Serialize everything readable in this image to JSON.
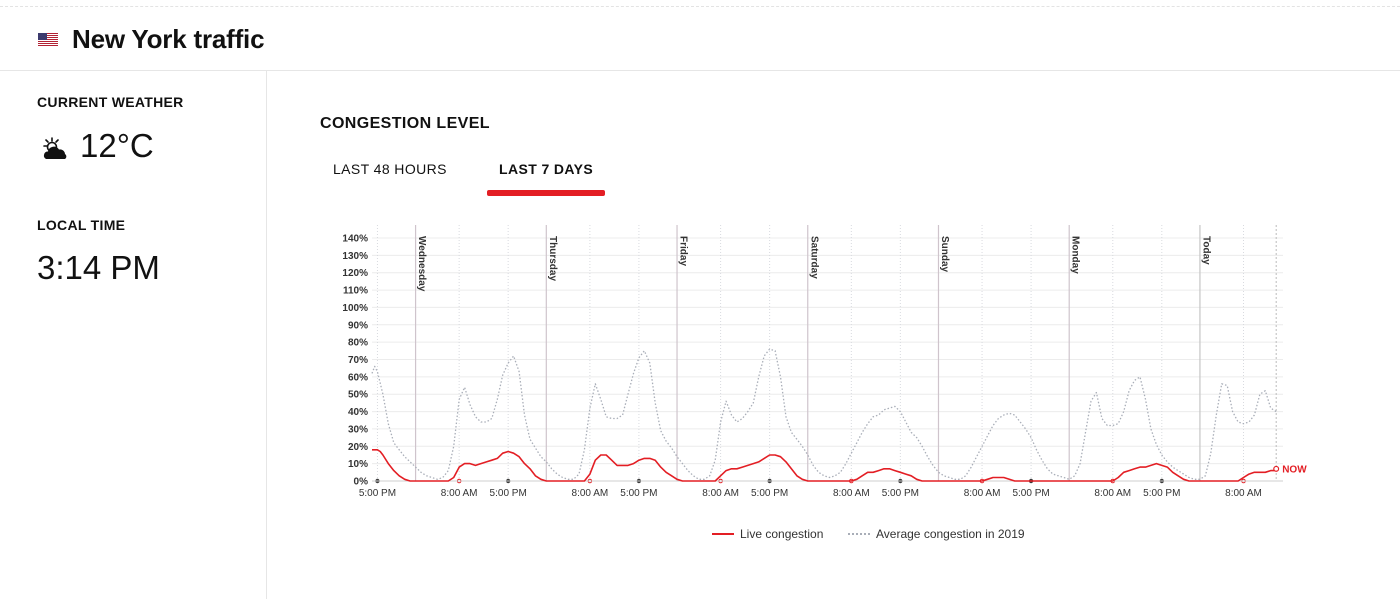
{
  "header": {
    "title": "New York traffic",
    "flag_icon": "us-flag-icon"
  },
  "sidebar": {
    "weather_label": "CURRENT WEATHER",
    "weather_icon": "partly-cloudy-icon",
    "temperature": "12°C",
    "time_label": "LOCAL TIME",
    "local_time": "3:14 PM"
  },
  "main": {
    "section_title": "CONGESTION LEVEL",
    "tabs": [
      {
        "label": "LAST 48 HOURS",
        "active": false
      },
      {
        "label": "LAST 7 DAYS",
        "active": true
      }
    ],
    "accent_color": "#e31e24"
  },
  "chart_data": {
    "type": "line",
    "ylim": [
      0,
      140
    ],
    "ytick_labels": [
      "0%",
      "10%",
      "20%",
      "30%",
      "40%",
      "50%",
      "60%",
      "70%",
      "80%",
      "90%",
      "100%",
      "110%",
      "120%",
      "130%",
      "140%"
    ],
    "x_range_hours": [
      -1,
      166.25
    ],
    "day_labels": [
      "Wednesday",
      "Thursday",
      "Friday",
      "Saturday",
      "Sunday",
      "Monday",
      "Today"
    ],
    "x_tick_labels": [
      "5:00 PM",
      "8:00 AM",
      "5:00 PM",
      "8:00 AM",
      "5:00 PM",
      "8:00 AM",
      "5:00 PM",
      "8:00 AM",
      "5:00 PM",
      "8:00 AM",
      "5:00 PM",
      "8:00 AM",
      "5:00 PM",
      "8:00 AM"
    ],
    "now_label": "NOW",
    "series": [
      {
        "name": "Live congestion",
        "color": "#e31e24",
        "style": "solid",
        "points": [
          [
            -1,
            18
          ],
          [
            0,
            18
          ],
          [
            0.5,
            17
          ],
          [
            1,
            15
          ],
          [
            2,
            10
          ],
          [
            3,
            6
          ],
          [
            4,
            3
          ],
          [
            5,
            1
          ],
          [
            6,
            0
          ],
          [
            13,
            0
          ],
          [
            14,
            2
          ],
          [
            15,
            8
          ],
          [
            16,
            10
          ],
          [
            17,
            10
          ],
          [
            18,
            9
          ],
          [
            19,
            10
          ],
          [
            20,
            11
          ],
          [
            21,
            12
          ],
          [
            22,
            13
          ],
          [
            23,
            16
          ],
          [
            24,
            17
          ],
          [
            25,
            16
          ],
          [
            26,
            14
          ],
          [
            27,
            10
          ],
          [
            28,
            7
          ],
          [
            29,
            3
          ],
          [
            30,
            1
          ],
          [
            31,
            0
          ],
          [
            38,
            0
          ],
          [
            39,
            4
          ],
          [
            40,
            12
          ],
          [
            41,
            15
          ],
          [
            42,
            15
          ],
          [
            43,
            12
          ],
          [
            44,
            9
          ],
          [
            45,
            9
          ],
          [
            46,
            9
          ],
          [
            47,
            10
          ],
          [
            48,
            12
          ],
          [
            49,
            13
          ],
          [
            50,
            13
          ],
          [
            51,
            12
          ],
          [
            52,
            8
          ],
          [
            53,
            5
          ],
          [
            54,
            3
          ],
          [
            55,
            1
          ],
          [
            56,
            0
          ],
          [
            62,
            0
          ],
          [
            63,
            3
          ],
          [
            64,
            6
          ],
          [
            65,
            7
          ],
          [
            66,
            7
          ],
          [
            67,
            8
          ],
          [
            68,
            9
          ],
          [
            69,
            10
          ],
          [
            70,
            11
          ],
          [
            71,
            13
          ],
          [
            72,
            15
          ],
          [
            73,
            15
          ],
          [
            74,
            14
          ],
          [
            75,
            11
          ],
          [
            76,
            7
          ],
          [
            77,
            3
          ],
          [
            78,
            1
          ],
          [
            79,
            0
          ],
          [
            87,
            0
          ],
          [
            88,
            1
          ],
          [
            89,
            3
          ],
          [
            90,
            5
          ],
          [
            91,
            5
          ],
          [
            92,
            6
          ],
          [
            93,
            7
          ],
          [
            94,
            7
          ],
          [
            95,
            6
          ],
          [
            96,
            5
          ],
          [
            97,
            4
          ],
          [
            98,
            3
          ],
          [
            99,
            1
          ],
          [
            100,
            0
          ],
          [
            111,
            0
          ],
          [
            112,
            1
          ],
          [
            113,
            2
          ],
          [
            114,
            2
          ],
          [
            115,
            2
          ],
          [
            116,
            1
          ],
          [
            117,
            0
          ],
          [
            135,
            0
          ],
          [
            136,
            2
          ],
          [
            137,
            5
          ],
          [
            138,
            6
          ],
          [
            139,
            7
          ],
          [
            140,
            8
          ],
          [
            141,
            8
          ],
          [
            142,
            9
          ],
          [
            143,
            10
          ],
          [
            144,
            9
          ],
          [
            145,
            8
          ],
          [
            146,
            5
          ],
          [
            147,
            3
          ],
          [
            148,
            1
          ],
          [
            149,
            0
          ],
          [
            158,
            0
          ],
          [
            159,
            2
          ],
          [
            160,
            4
          ],
          [
            161,
            5
          ],
          [
            162,
            5
          ],
          [
            163,
            5
          ],
          [
            164,
            6
          ],
          [
            165,
            6
          ]
        ]
      },
      {
        "name": "Average congestion in 2019",
        "color": "#a9aeb8",
        "style": "dotted",
        "points": [
          [
            -1,
            62
          ],
          [
            -0.5,
            66
          ],
          [
            0,
            63
          ],
          [
            1,
            50
          ],
          [
            2,
            33
          ],
          [
            3,
            22
          ],
          [
            4,
            18
          ],
          [
            5,
            14
          ],
          [
            6,
            11
          ],
          [
            7,
            8
          ],
          [
            8,
            5
          ],
          [
            9,
            3
          ],
          [
            10,
            2
          ],
          [
            11,
            1
          ],
          [
            12,
            2
          ],
          [
            13,
            6
          ],
          [
            14,
            20
          ],
          [
            15,
            47
          ],
          [
            16,
            54
          ],
          [
            17,
            44
          ],
          [
            18,
            37
          ],
          [
            19,
            34
          ],
          [
            20,
            34
          ],
          [
            21,
            36
          ],
          [
            22,
            47
          ],
          [
            23,
            61
          ],
          [
            24,
            68
          ],
          [
            25,
            72
          ],
          [
            26,
            63
          ],
          [
            27,
            38
          ],
          [
            28,
            24
          ],
          [
            29,
            19
          ],
          [
            30,
            14
          ],
          [
            31,
            11
          ],
          [
            32,
            7
          ],
          [
            33,
            4
          ],
          [
            34,
            2
          ],
          [
            35,
            1
          ],
          [
            36,
            1
          ],
          [
            37,
            4
          ],
          [
            38,
            18
          ],
          [
            39,
            42
          ],
          [
            40,
            56
          ],
          [
            41,
            47
          ],
          [
            42,
            37
          ],
          [
            43,
            36
          ],
          [
            44,
            36
          ],
          [
            45,
            38
          ],
          [
            46,
            50
          ],
          [
            47,
            62
          ],
          [
            48,
            71
          ],
          [
            49,
            75
          ],
          [
            50,
            68
          ],
          [
            51,
            45
          ],
          [
            52,
            29
          ],
          [
            53,
            23
          ],
          [
            54,
            19
          ],
          [
            55,
            14
          ],
          [
            56,
            10
          ],
          [
            57,
            6
          ],
          [
            58,
            3
          ],
          [
            59,
            1
          ],
          [
            60,
            1
          ],
          [
            61,
            3
          ],
          [
            62,
            12
          ],
          [
            63,
            34
          ],
          [
            64,
            46
          ],
          [
            65,
            38
          ],
          [
            66,
            34
          ],
          [
            67,
            36
          ],
          [
            68,
            40
          ],
          [
            69,
            45
          ],
          [
            70,
            60
          ],
          [
            71,
            72
          ],
          [
            72,
            76
          ],
          [
            73,
            75
          ],
          [
            74,
            60
          ],
          [
            75,
            37
          ],
          [
            76,
            28
          ],
          [
            77,
            24
          ],
          [
            78,
            20
          ],
          [
            79,
            15
          ],
          [
            80,
            9
          ],
          [
            81,
            5
          ],
          [
            82,
            3
          ],
          [
            83,
            2
          ],
          [
            84,
            3
          ],
          [
            85,
            5
          ],
          [
            86,
            10
          ],
          [
            87,
            16
          ],
          [
            88,
            22
          ],
          [
            89,
            28
          ],
          [
            90,
            33
          ],
          [
            91,
            37
          ],
          [
            92,
            38
          ],
          [
            93,
            41
          ],
          [
            94,
            42
          ],
          [
            95,
            43
          ],
          [
            96,
            40
          ],
          [
            97,
            34
          ],
          [
            98,
            28
          ],
          [
            99,
            25
          ],
          [
            100,
            20
          ],
          [
            101,
            14
          ],
          [
            102,
            9
          ],
          [
            103,
            5
          ],
          [
            104,
            3
          ],
          [
            105,
            2
          ],
          [
            106,
            1
          ],
          [
            107,
            1
          ],
          [
            108,
            3
          ],
          [
            109,
            8
          ],
          [
            110,
            14
          ],
          [
            111,
            20
          ],
          [
            112,
            26
          ],
          [
            113,
            32
          ],
          [
            114,
            36
          ],
          [
            115,
            38
          ],
          [
            116,
            39
          ],
          [
            117,
            38
          ],
          [
            118,
            34
          ],
          [
            119,
            30
          ],
          [
            120,
            25
          ],
          [
            121,
            18
          ],
          [
            122,
            12
          ],
          [
            123,
            7
          ],
          [
            124,
            4
          ],
          [
            125,
            3
          ],
          [
            126,
            2
          ],
          [
            127,
            1
          ],
          [
            128,
            3
          ],
          [
            129,
            10
          ],
          [
            130,
            28
          ],
          [
            131,
            46
          ],
          [
            132,
            51
          ],
          [
            133,
            36
          ],
          [
            134,
            32
          ],
          [
            135,
            32
          ],
          [
            136,
            33
          ],
          [
            137,
            40
          ],
          [
            138,
            52
          ],
          [
            139,
            58
          ],
          [
            140,
            60
          ],
          [
            141,
            47
          ],
          [
            142,
            30
          ],
          [
            143,
            21
          ],
          [
            144,
            15
          ],
          [
            145,
            11
          ],
          [
            146,
            8
          ],
          [
            147,
            6
          ],
          [
            148,
            4
          ],
          [
            149,
            2
          ],
          [
            150,
            1
          ],
          [
            151,
            1
          ],
          [
            152,
            3
          ],
          [
            153,
            16
          ],
          [
            154,
            38
          ],
          [
            155,
            56
          ],
          [
            156,
            55
          ],
          [
            157,
            40
          ],
          [
            158,
            34
          ],
          [
            159,
            33
          ],
          [
            160,
            34
          ],
          [
            161,
            38
          ],
          [
            162,
            50
          ],
          [
            163,
            52
          ],
          [
            164,
            42
          ],
          [
            165,
            40
          ]
        ]
      }
    ],
    "now_value": 7
  }
}
